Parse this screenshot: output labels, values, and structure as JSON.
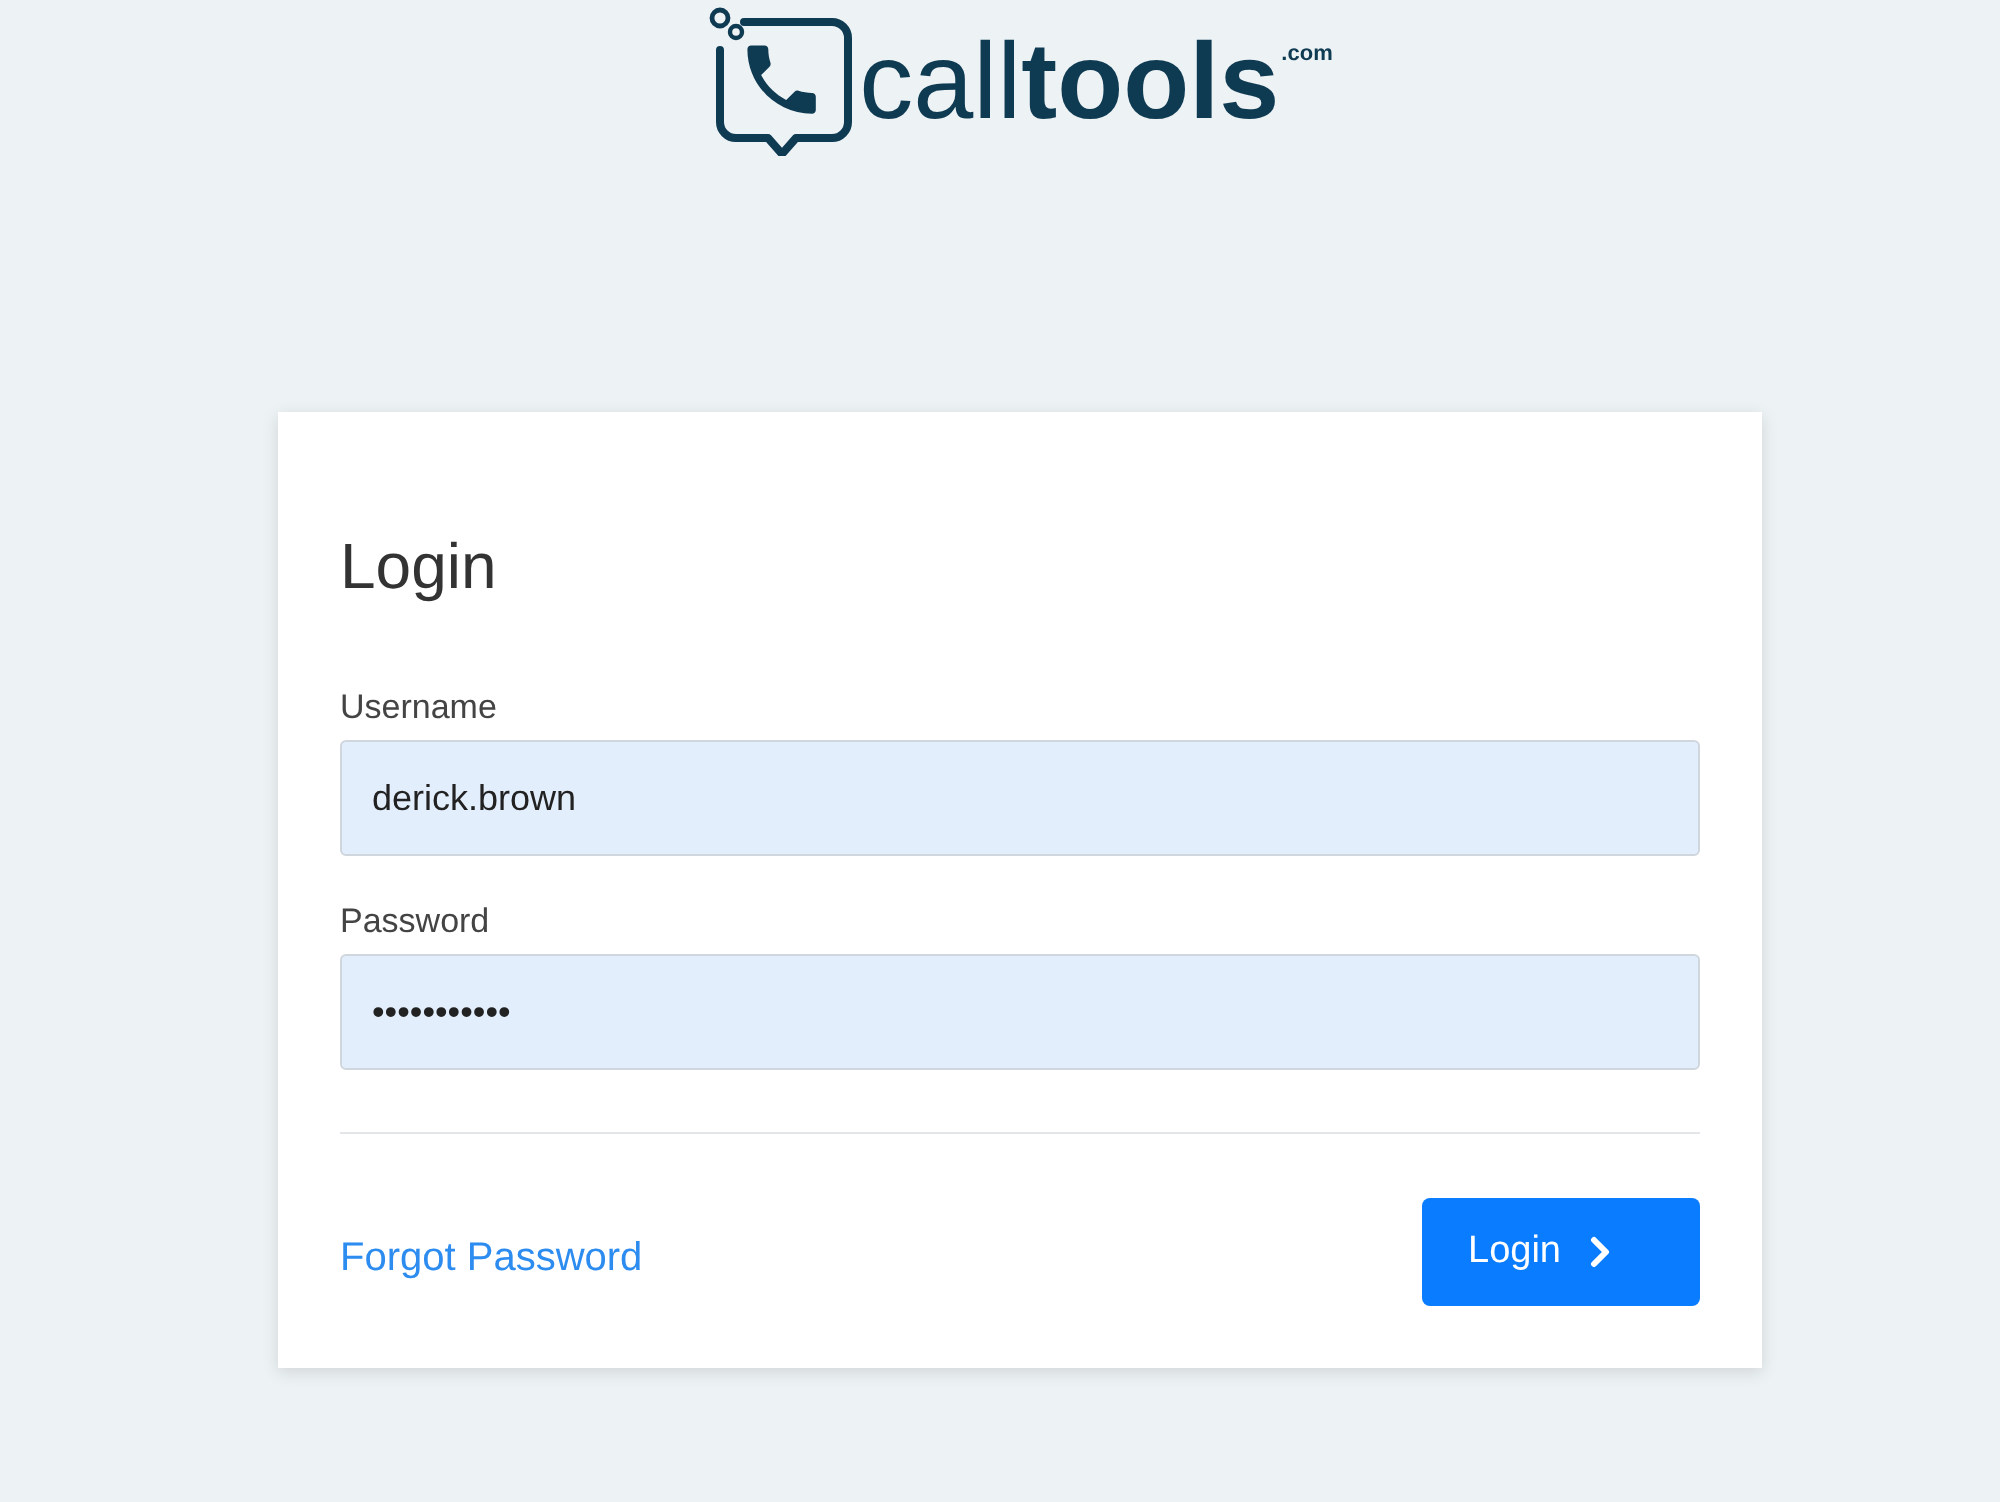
{
  "logo": {
    "name": "call**tools**",
    "suffix": ".com"
  },
  "form": {
    "title": "Login",
    "fields": [
      {
        "label": "Username",
        "value": "derick.brown"
      },
      {
        "label": "Password",
        "value": "•••••••••••"
      }
    ]
  },
  "forgot_link": "Forgot Password",
  "submit_button": "Login"
}
